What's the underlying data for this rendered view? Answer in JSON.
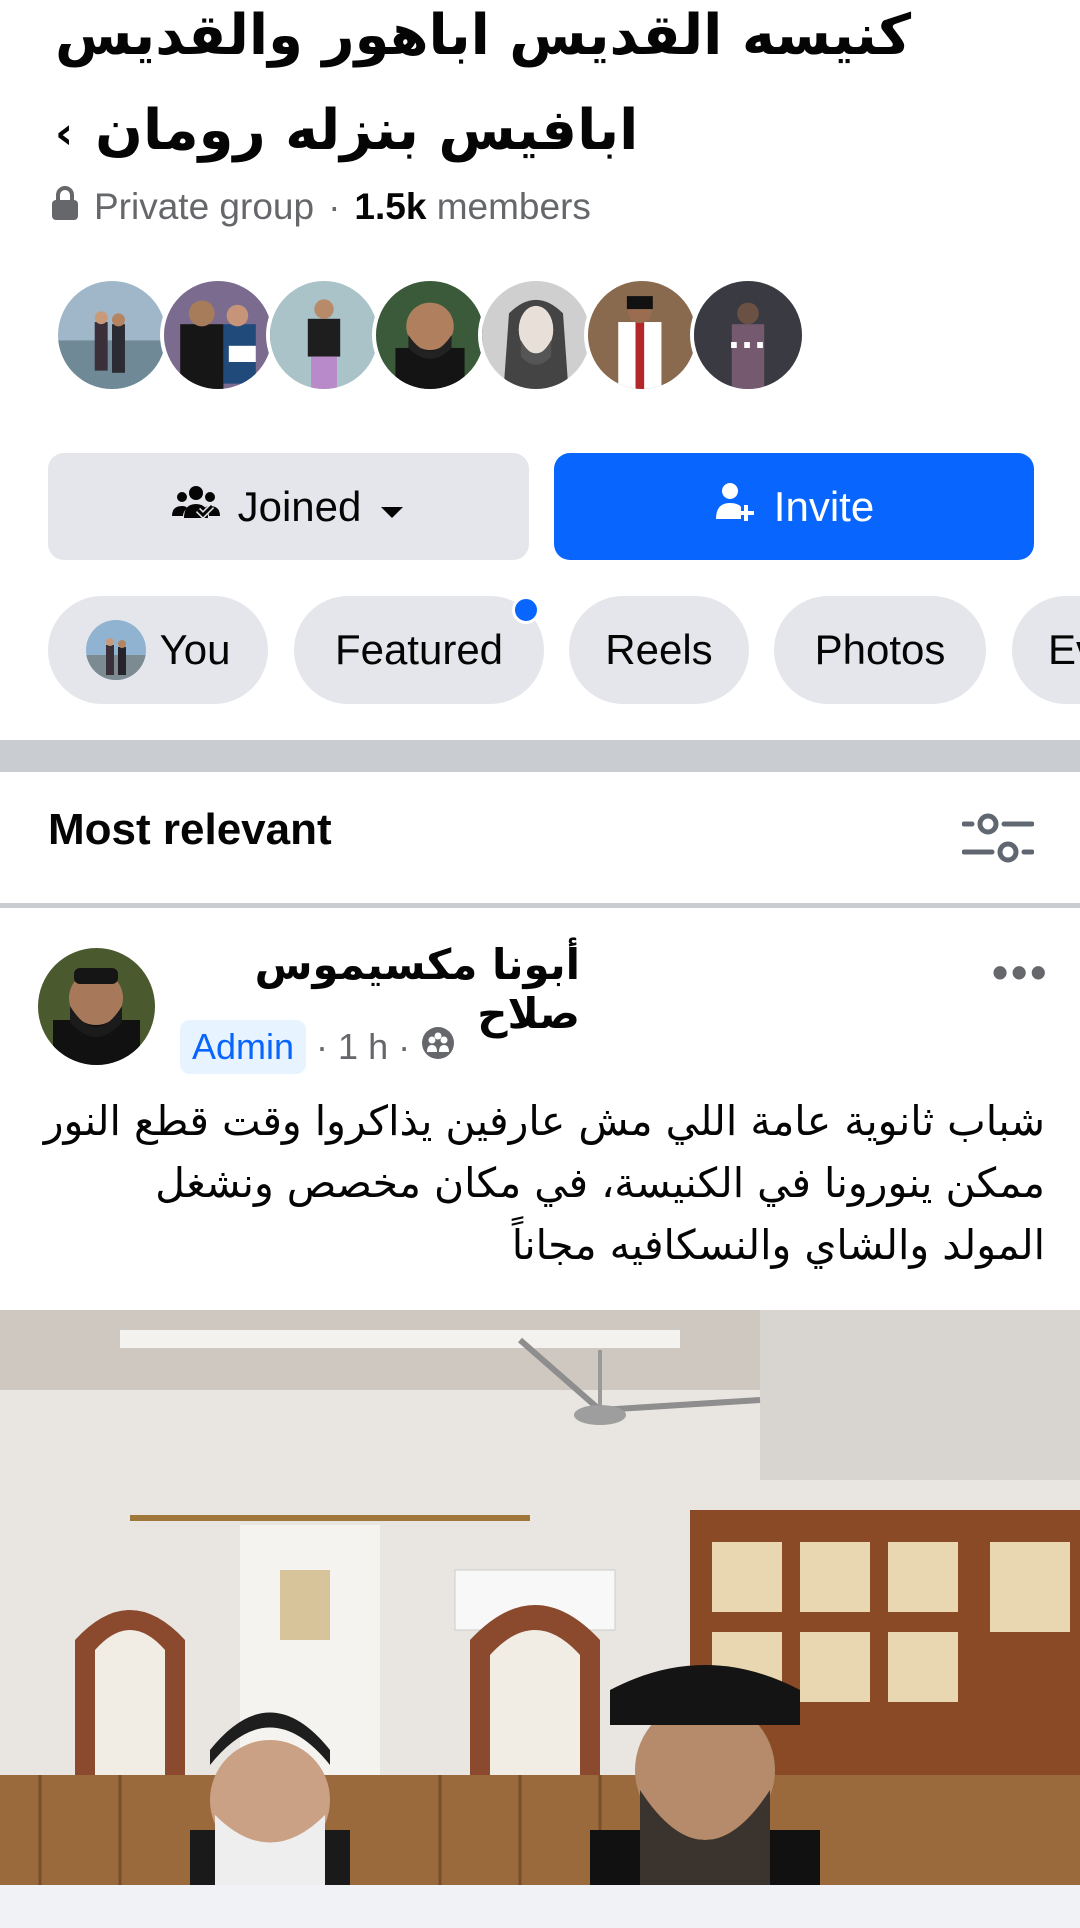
{
  "group": {
    "title_line1": "كنيسه القديس اباهور والقديس",
    "title_line2": "ابافيس بنزله رومان",
    "privacy": "Private group",
    "separator": "·",
    "member_count": "1.5k",
    "members_label": "members",
    "avatars": [
      "member-1",
      "member-2",
      "member-3",
      "member-4",
      "member-5",
      "member-6",
      "member-7"
    ],
    "more_members": "..."
  },
  "actions": {
    "joined_label": "Joined",
    "invite_label": "Invite"
  },
  "tabs": [
    {
      "label": "You"
    },
    {
      "label": "Featured",
      "has_dot": true
    },
    {
      "label": "Reels"
    },
    {
      "label": "Photos"
    },
    {
      "label": "Ev"
    }
  ],
  "feed": {
    "sort_label": "Most relevant"
  },
  "post": {
    "author": "أبونا مكسيموس صلاح",
    "role_badge": "Admin",
    "time": "1 h",
    "sep": "·",
    "text": "شباب ثانوية عامة اللي مش عارفين يذاكروا وقت قطع النور ممكن ينورونا في الكنيسة، في مكان مخصص ونشغل المولد والشاي والنسكافيه مجاناً",
    "menu": "•••"
  },
  "colors": {
    "accent": "#0866ff",
    "chip_bg": "#e4e6eb",
    "secondary_text": "#65676b",
    "divider": "#c9ccd1"
  },
  "icons": {
    "lock": "lock-icon",
    "joined": "group-people-icon",
    "dropdown": "caret-down-icon",
    "invite": "add-person-icon",
    "filter": "sliders-icon",
    "audience": "group-audience-icon"
  }
}
